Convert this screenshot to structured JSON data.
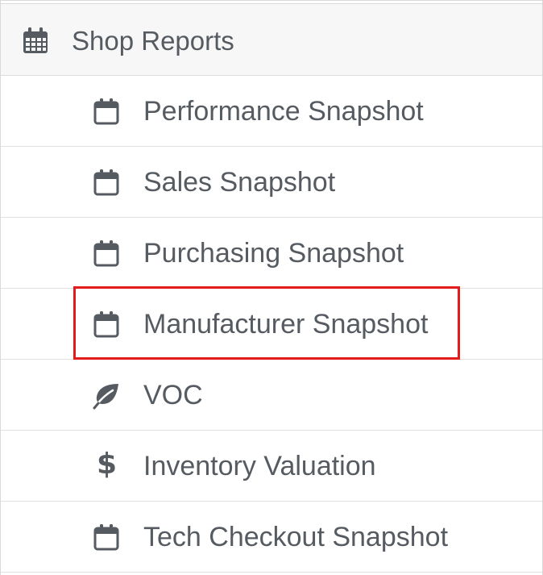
{
  "menu": {
    "header": {
      "label": "Shop Reports",
      "icon": "calendar-grid-icon"
    },
    "items": [
      {
        "label": "Performance Snapshot",
        "icon": "calendar-icon"
      },
      {
        "label": "Sales Snapshot",
        "icon": "calendar-icon"
      },
      {
        "label": "Purchasing Snapshot",
        "icon": "calendar-icon"
      },
      {
        "label": "Manufacturer Snapshot",
        "icon": "calendar-icon",
        "highlighted": true
      },
      {
        "label": "VOC",
        "icon": "leaf-icon"
      },
      {
        "label": "Inventory Valuation",
        "icon": "dollar-icon",
        "glyph": "$"
      },
      {
        "label": "Tech Checkout Snapshot",
        "icon": "calendar-icon"
      }
    ]
  },
  "colors": {
    "text": "#555b61",
    "header_bg": "#f7f7f7",
    "divider": "#e0e0e0",
    "highlight_border": "#e31b1b"
  }
}
